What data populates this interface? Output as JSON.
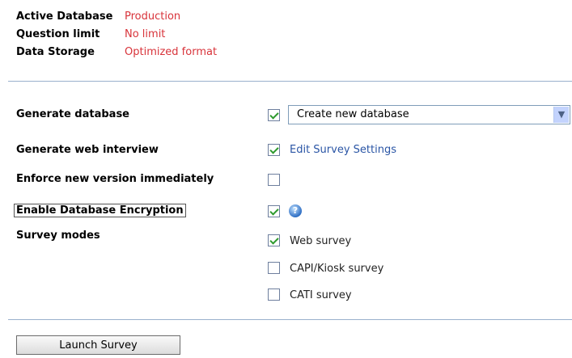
{
  "info": {
    "active_database": {
      "label": "Active Database",
      "value": "Production"
    },
    "question_limit": {
      "label": "Question limit",
      "value": "No limit"
    },
    "data_storage": {
      "label": "Data Storage",
      "value": "Optimized format"
    }
  },
  "options": {
    "generate_database": {
      "label": "Generate database",
      "checked": true,
      "select_value": "Create new database"
    },
    "generate_web_interview": {
      "label": "Generate web interview",
      "checked": true,
      "link": "Edit Survey Settings"
    },
    "enforce_new_version": {
      "label": "Enforce new version immediately",
      "checked": false
    },
    "enable_encryption": {
      "label": "Enable Database Encryption",
      "checked": true,
      "help_icon": "help-icon"
    },
    "survey_modes": {
      "label": "Survey modes",
      "modes": [
        {
          "label": "Web survey",
          "checked": true
        },
        {
          "label": "CAPI/Kiosk survey",
          "checked": false
        },
        {
          "label": "CATI survey",
          "checked": false
        }
      ]
    }
  },
  "launch_button": {
    "label": "Launch Survey"
  },
  "colors": {
    "value_text": "#d8333a",
    "link": "#2a55a5",
    "separator": "#9ab0cc",
    "checkmark": "#2e9a2e"
  }
}
